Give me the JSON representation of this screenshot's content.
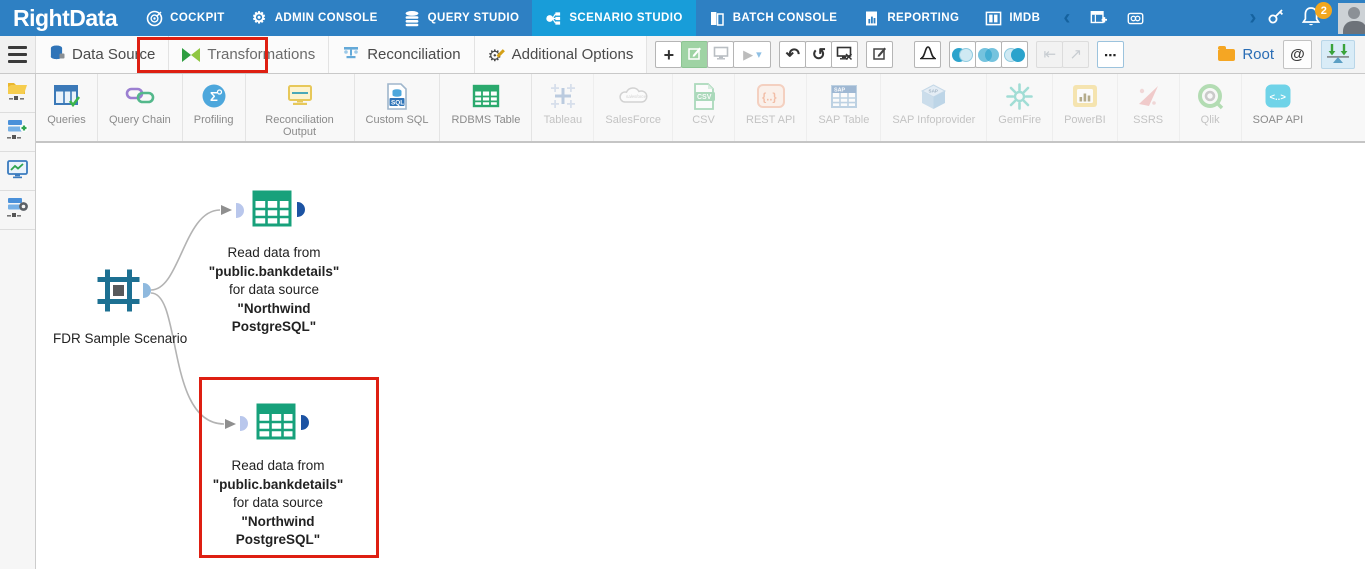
{
  "topbar": {
    "logo": "RightData",
    "nav": [
      {
        "label": "COCKPIT",
        "icon": "cockpit-icon",
        "active": false
      },
      {
        "label": "ADMIN CONSOLE",
        "icon": "admin-console-icon",
        "active": false
      },
      {
        "label": "QUERY STUDIO",
        "icon": "query-studio-icon",
        "active": false
      },
      {
        "label": "SCENARIO STUDIO",
        "icon": "scenario-studio-icon",
        "active": true
      },
      {
        "label": "BATCH CONSOLE",
        "icon": "batch-console-icon",
        "active": false
      },
      {
        "label": "REPORTING",
        "icon": "reporting-icon",
        "active": false
      },
      {
        "label": "IMDB",
        "icon": "imdb-icon",
        "active": false
      }
    ],
    "overflow_icons": [
      "table-plus-icon",
      "link-card-icon"
    ],
    "notification_count": "2",
    "right_icons": [
      "key-icon",
      "bell-icon",
      "user-avatar"
    ]
  },
  "tabs": {
    "items": [
      {
        "label": "Data Source",
        "icon": "database-icon"
      },
      {
        "label": "Transformations",
        "icon": "bowtie-icon",
        "annotated": true
      },
      {
        "label": "Reconciliation",
        "icon": "balance-icon"
      },
      {
        "label": "Additional Options",
        "icon": "gear-wrench-icon"
      }
    ]
  },
  "toolbar": {
    "root_label": "Root",
    "buttons": [
      "add",
      "edit-active",
      "monitor",
      "run",
      "undo",
      "history",
      "export-monitor",
      "edit",
      "distribution",
      "venn-left",
      "venn-full",
      "venn-right",
      "collapse",
      "open-external",
      "more-options",
      "locate",
      "auto-arrange"
    ]
  },
  "icons": {
    "plus": "+",
    "play": "▶",
    "caret": "▾",
    "undo": "↶",
    "history": "↺",
    "collapse": "⇤",
    "external": "↗",
    "gear": "⚙",
    "at": "@",
    "dots": "▪▪▪",
    "chevron_left": "‹",
    "chevron_right": "›",
    "sigma": "Σ",
    "braces": "{..}",
    "soap": "<..>",
    "sql": "SQL",
    "csv": "CSV",
    "sap": "SAP"
  },
  "palette": {
    "items": [
      {
        "label": "Queries",
        "icon": "queries-icon",
        "enabled": true
      },
      {
        "label": "Query Chain",
        "icon": "query-chain-icon",
        "enabled": true
      },
      {
        "label": "Profiling",
        "icon": "profiling-icon",
        "enabled": true
      },
      {
        "label": "Reconciliation Output",
        "icon": "reconciliation-output-icon",
        "enabled": true
      },
      {
        "label": "Custom SQL",
        "icon": "custom-sql-icon",
        "enabled": true
      },
      {
        "label": "RDBMS Table",
        "icon": "rdbms-table-icon",
        "enabled": true
      },
      {
        "label": "Tableau",
        "icon": "tableau-icon",
        "enabled": false
      },
      {
        "label": "SalesForce",
        "icon": "salesforce-icon",
        "enabled": false
      },
      {
        "label": "CSV",
        "icon": "csv-icon",
        "enabled": false
      },
      {
        "label": "REST API",
        "icon": "rest-api-icon",
        "enabled": false
      },
      {
        "label": "SAP Table",
        "icon": "sap-table-icon",
        "enabled": false
      },
      {
        "label": "SAP Infoprovider",
        "icon": "sap-infoprovider-icon",
        "enabled": false
      },
      {
        "label": "GemFire",
        "icon": "gemfire-icon",
        "enabled": false
      },
      {
        "label": "PowerBI",
        "icon": "powerbi-icon",
        "enabled": false
      },
      {
        "label": "SSRS",
        "icon": "ssrs-icon",
        "enabled": false
      },
      {
        "label": "Qlik",
        "icon": "qlik-icon",
        "enabled": false
      },
      {
        "label": "SOAP API",
        "icon": "soap-api-icon",
        "enabled": false
      }
    ]
  },
  "sidebar": {
    "items": [
      "folder-network-icon",
      "source-add-icon",
      "monitor-chart-icon",
      "source-settings-icon"
    ]
  },
  "canvas": {
    "scenario_label": "FDR Sample Scenario",
    "nodes": [
      {
        "lines": [
          "Read data from",
          "\"public.bankdetails\"",
          "for data source",
          "\"Northwind",
          "PostgreSQL\""
        ]
      },
      {
        "lines": [
          "Read data from",
          "\"public.bankdetails\"",
          "for data source",
          "\"Northwind",
          "PostgreSQL\""
        ]
      }
    ]
  },
  "colors": {
    "topbar_blue": "#2e80c3",
    "active_tab_blue": "#189dd9",
    "table_green": "#17a17b",
    "scenario_teal": "#1d7092",
    "annotation_red": "#de1f12",
    "badge_orange": "#f2a71f"
  }
}
